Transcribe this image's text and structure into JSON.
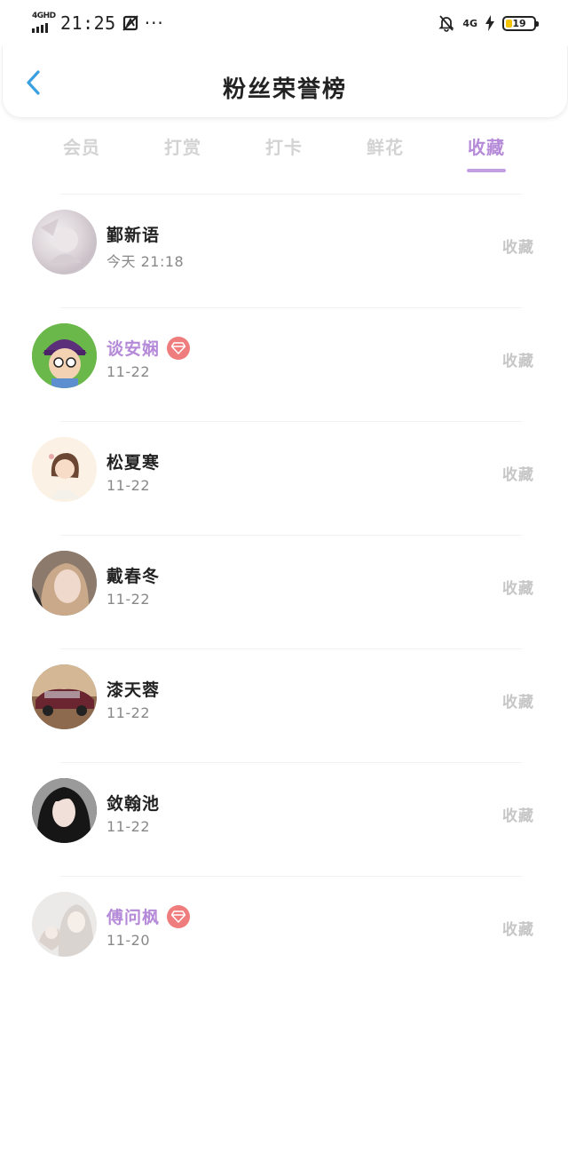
{
  "status_bar": {
    "network": "4GHD",
    "time": "21:25",
    "more": "···",
    "net2": "4G",
    "battery": "19"
  },
  "header": {
    "title": "粉丝荣誉榜"
  },
  "tabs": [
    {
      "label": "会员"
    },
    {
      "label": "打赏"
    },
    {
      "label": "打卡"
    },
    {
      "label": "鲜花"
    },
    {
      "label": "收藏"
    }
  ],
  "colors": {
    "accent": "#b58ad8",
    "gem": "#f07d7d",
    "back_arrow": "#3aa0e0"
  },
  "rows": [
    {
      "name": "鄞新语",
      "time": "今天 21:18",
      "action": "收藏",
      "vip": false
    },
    {
      "name": "谈安娴",
      "time": "11-22",
      "action": "收藏",
      "vip": true
    },
    {
      "name": "松夏寒",
      "time": "11-22",
      "action": "收藏",
      "vip": false
    },
    {
      "name": "戴春冬",
      "time": "11-22",
      "action": "收藏",
      "vip": false
    },
    {
      "name": "漆天蓉",
      "time": "11-22",
      "action": "收藏",
      "vip": false
    },
    {
      "name": "敛翰池",
      "time": "11-22",
      "action": "收藏",
      "vip": false
    },
    {
      "name": "傅问枫",
      "time": "11-20",
      "action": "收藏",
      "vip": true
    }
  ]
}
